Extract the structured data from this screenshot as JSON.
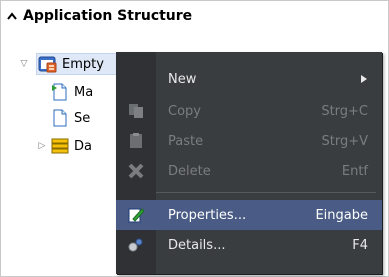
{
  "panel": {
    "title": "Application Structure",
    "caret": "^"
  },
  "tree": [
    {
      "label": "Empty",
      "level": 0,
      "expander": "▽",
      "icon": "app-icon",
      "selected": true
    },
    {
      "label": "Ma",
      "level": 1,
      "expander": "",
      "icon": "page-green-icon"
    },
    {
      "label": "Se",
      "level": 1,
      "expander": "",
      "icon": "page-icon"
    },
    {
      "label": "Da",
      "level": 1,
      "expander": "▷",
      "icon": "database-icon"
    }
  ],
  "menu": {
    "items": [
      {
        "label": "New",
        "shortcut": "",
        "icon": "",
        "enabled": true,
        "submenu": true
      },
      {
        "label": "Copy",
        "shortcut": "Strg+C",
        "icon": "copy-icon",
        "enabled": false
      },
      {
        "label": "Paste",
        "shortcut": "Strg+V",
        "icon": "paste-icon",
        "enabled": false
      },
      {
        "label": "Delete",
        "shortcut": "Entf",
        "icon": "delete-icon",
        "enabled": false
      },
      {
        "label": "Properties...",
        "shortcut": "Eingabe",
        "icon": "properties-icon",
        "enabled": true,
        "hover": true
      },
      {
        "label": "Details...",
        "shortcut": "F4",
        "icon": "details-icon",
        "enabled": true
      }
    ]
  }
}
